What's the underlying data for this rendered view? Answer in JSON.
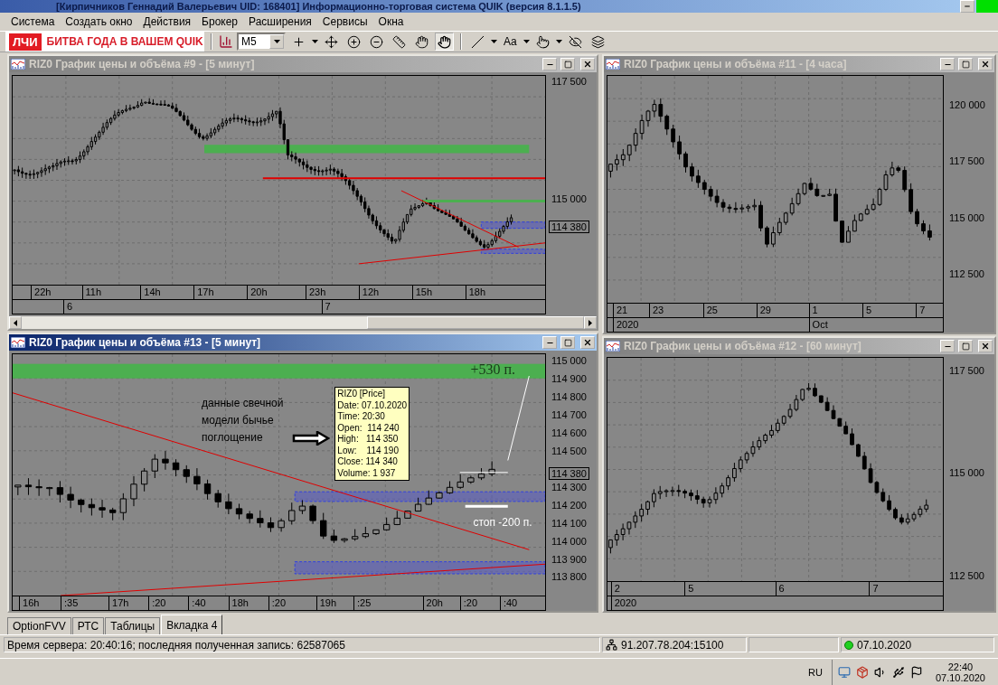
{
  "window": {
    "title": "[Кирпичников Геннадий Валерьевич UID: 168401] Информационно-торговая система QUIK (версия 8.1.1.5)"
  },
  "menu": [
    "Система",
    "Создать окно",
    "Действия",
    "Брокер",
    "Расширения",
    "Сервисы",
    "Окна"
  ],
  "toolbar": {
    "banner_logo": "ЛЧИ",
    "banner_text": "БИТВА ГОДА В ВАШЕМ QUIK",
    "interval": "M5",
    "font_button": "Aa"
  },
  "charts": [
    {
      "title": "RIZ0 График цены и объёма #9 - [5 минут]",
      "active": false,
      "scrollbar": true,
      "price_ticks": [
        "117 500",
        "115 000"
      ],
      "last_price": "114 380",
      "time_ticks": [
        "22h",
        "11h",
        "14h",
        "17h",
        "20h",
        "23h",
        "12h",
        "15h",
        "18h"
      ],
      "date_ticks": [
        "6",
        "7"
      ]
    },
    {
      "title": "RIZ0 График цены и объёма #13 - [5 минут]",
      "active": true,
      "price_ticks": [
        "115 000",
        "114 900",
        "114 800",
        "114 700",
        "114 600",
        "114 500",
        "114 300",
        "114 200",
        "114 100",
        "114 000",
        "113 900",
        "113 800"
      ],
      "last_price": "114 380",
      "time_ticks": [
        "16h",
        ":35",
        "17h",
        ":20",
        ":40",
        "18h",
        ":20",
        "19h",
        ":25",
        "20h",
        ":20",
        ":40"
      ],
      "annotations": {
        "note": "данные свечной модели бычье поглощение",
        "tooltip": [
          "RIZ0 [Price]",
          "Date: 07.10.2020",
          "Time: 20:30",
          "Open:  114 240",
          "High:   114 350",
          "Low:    114 190",
          "Close: 114 340",
          "Volume: 1 937"
        ],
        "target": "+530 п.",
        "stop": "стоп -200 п."
      }
    },
    {
      "title": "RIZ0 График цены и объёма #11 - [4 часа]",
      "active": false,
      "price_ticks": [
        "120 000",
        "117 500",
        "115 000",
        "112 500"
      ],
      "time_ticks": [
        "21",
        "23",
        "25",
        "29",
        "1",
        "5",
        "7"
      ],
      "date_ticks": [
        "2020",
        "Oct"
      ]
    },
    {
      "title": "RIZ0 График цены и объёма #12 - [60 минут]",
      "active": false,
      "price_ticks": [
        "117 500",
        "115 000",
        "112 500"
      ],
      "time_ticks": [
        "2",
        "5",
        "6",
        "7"
      ],
      "date_ticks": [
        "2020"
      ]
    }
  ],
  "tabs": [
    {
      "label": "OptionFVV",
      "selected": false
    },
    {
      "label": "РТС",
      "selected": false
    },
    {
      "label": "Таблицы",
      "selected": false
    },
    {
      "label": "Вкладка 4",
      "selected": true
    }
  ],
  "status_bar": {
    "message": "Время сервера: 20:40:16; последняя полученная запись: 62587065",
    "server": "91.207.78.204:15100",
    "date": "07.10.2020"
  },
  "taskbar": {
    "language": "RU",
    "time": "22:40",
    "date": "07.10.2020"
  }
}
